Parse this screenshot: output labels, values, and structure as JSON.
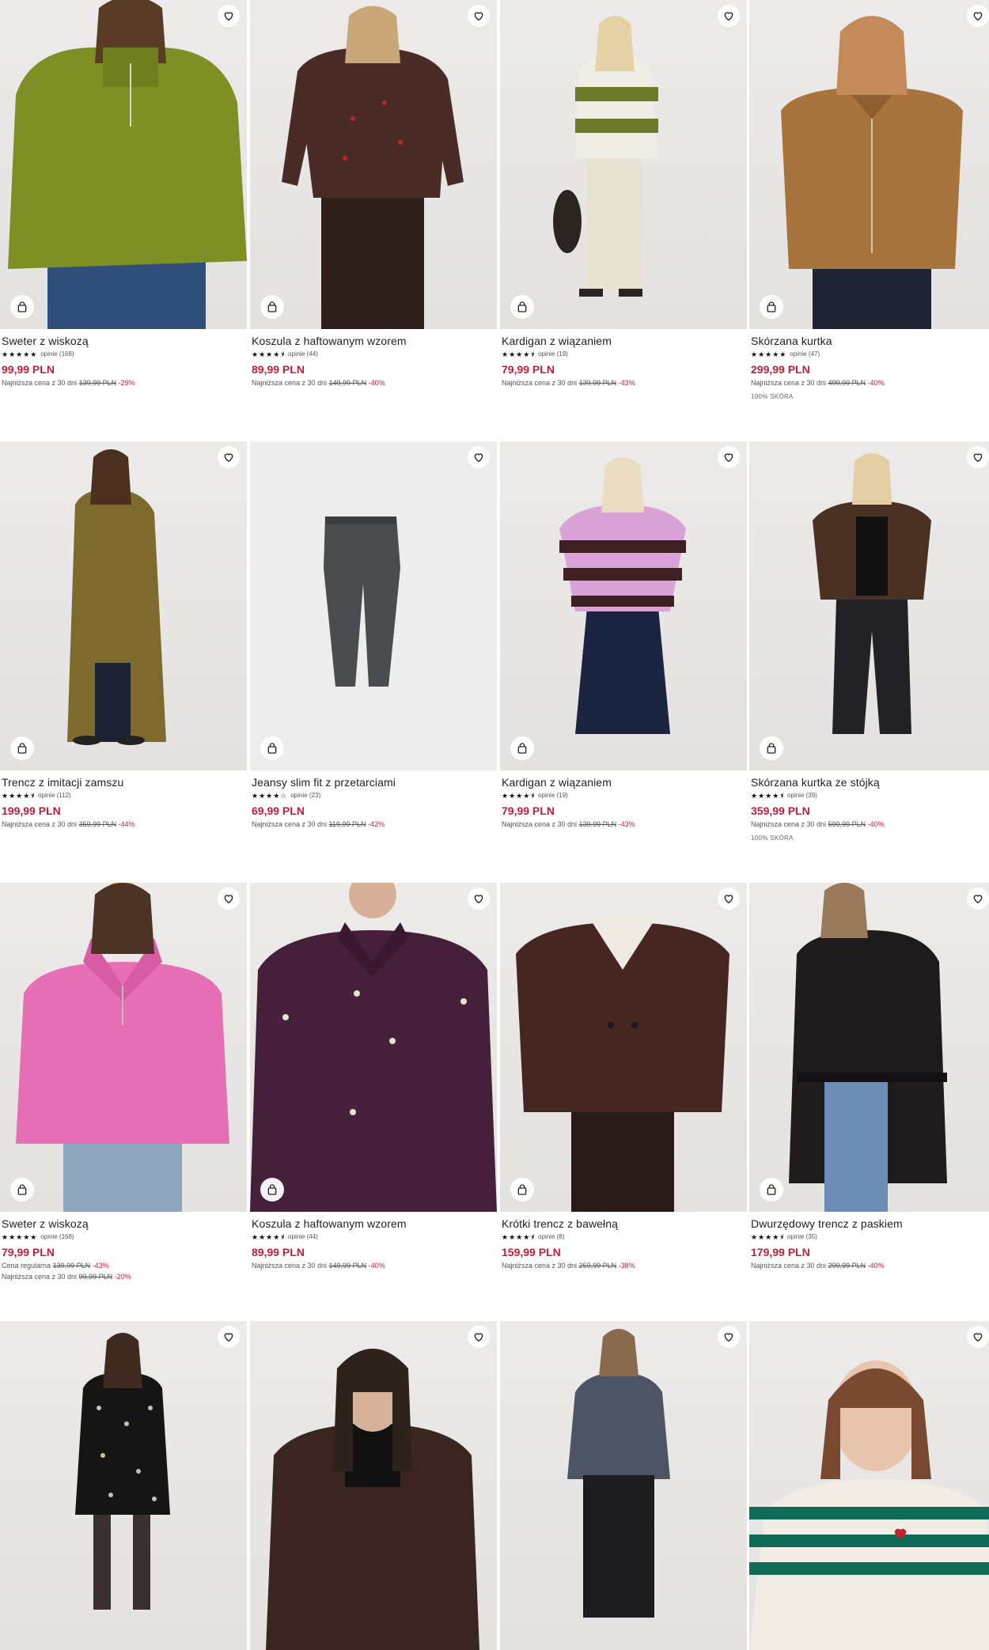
{
  "colors": {
    "price": "#c21d3d",
    "discount": "#c21d3d"
  },
  "icons": {
    "favorite": "heart-icon",
    "cart": "shopping-bag-icon",
    "rating": "star-icon"
  },
  "products": [
    {
      "name": "Sweter z wiskozą",
      "stars": "★★★★★",
      "reviews": "opinie (168)",
      "price": "99,99 PLN",
      "lines": [
        {
          "label": "Najniższa cena z 30 dni",
          "old": "139,99 PLN",
          "discount": "-29%"
        }
      ]
    },
    {
      "name": "Koszula z haftowanym wzorem",
      "stars": "★★★★⯨",
      "reviews": "opinie (44)",
      "price": "89,99 PLN",
      "lines": [
        {
          "label": "Najniższa cena z 30 dni",
          "old": "149,99 PLN",
          "discount": "-40%"
        }
      ]
    },
    {
      "name": "Kardigan z wiązaniem",
      "stars": "★★★★⯨",
      "reviews": "opinie (19)",
      "price": "79,99 PLN",
      "lines": [
        {
          "label": "Najniższa cena z 30 dni",
          "old": "139,99 PLN",
          "discount": "-43%"
        }
      ]
    },
    {
      "name": "Skórzana kurtka",
      "stars": "★★★★★",
      "reviews": "opinie (47)",
      "price": "299,99 PLN",
      "lines": [
        {
          "label": "Najniższa cena z 30 dni",
          "old": "499,99 PLN",
          "discount": "-40%"
        }
      ],
      "material": "100% SKÓRA"
    },
    {
      "name": "Trencz z imitacji zamszu",
      "stars": "★★★★⯨",
      "reviews": "opinie (112)",
      "price": "199,99 PLN",
      "lines": [
        {
          "label": "Najniższa cena z 30 dni",
          "old": "359,99 PLN",
          "discount": "-44%"
        }
      ]
    },
    {
      "name": "Jeansy slim fit z przetarciami",
      "stars": "★★★★☆",
      "reviews": "opinie (23)",
      "price": "69,99 PLN",
      "lines": [
        {
          "label": "Najniższa cena z 30 dni",
          "old": "119,99 PLN",
          "discount": "-42%"
        }
      ]
    },
    {
      "name": "Kardigan z wiązaniem",
      "stars": "★★★★⯨",
      "reviews": "opinie (19)",
      "price": "79,99 PLN",
      "lines": [
        {
          "label": "Najniższa cena z 30 dni",
          "old": "139,99 PLN",
          "discount": "-43%"
        }
      ]
    },
    {
      "name": "Skórzana kurtka ze stójką",
      "stars": "★★★★⯨",
      "reviews": "opinie (39)",
      "price": "359,99 PLN",
      "lines": [
        {
          "label": "Najniższa cena z 30 dni",
          "old": "599,99 PLN",
          "discount": "-40%"
        }
      ],
      "material": "100% SKÓRA"
    },
    {
      "name": "Sweter z wiskozą",
      "stars": "★★★★★",
      "reviews": "opinie (168)",
      "price": "79,99 PLN",
      "lines": [
        {
          "label": "Cena regularna",
          "old": "139,99 PLN",
          "discount": "-43%"
        },
        {
          "label": "Najniższa cena z 30 dni",
          "old": "99,99 PLN",
          "discount": "-20%"
        }
      ]
    },
    {
      "name": "Koszula z haftowanym wzorem",
      "stars": "★★★★⯨",
      "reviews": "opinie (44)",
      "price": "89,99 PLN",
      "lines": [
        {
          "label": "Najniższa cena z 30 dni",
          "old": "149,99 PLN",
          "discount": "-40%"
        }
      ]
    },
    {
      "name": "Krótki trencz z bawełną",
      "stars": "★★★★⯨",
      "reviews": "opinie (8)",
      "price": "159,99 PLN",
      "lines": [
        {
          "label": "Najniższa cena z 30 dni",
          "old": "259,99 PLN",
          "discount": "-38%"
        }
      ]
    },
    {
      "name": "Dwurzędowy trencz z paskiem",
      "stars": "★★★★⯨",
      "reviews": "opinie (35)",
      "price": "179,99 PLN",
      "lines": [
        {
          "label": "Najniższa cena z 30 dni",
          "old": "299,99 PLN",
          "discount": "-40%"
        }
      ]
    },
    {
      "name": "",
      "stars": "",
      "reviews": "",
      "price": "",
      "lines": []
    },
    {
      "name": "",
      "stars": "",
      "reviews": "",
      "price": "",
      "lines": []
    },
    {
      "name": "",
      "stars": "",
      "reviews": "",
      "price": "",
      "lines": []
    },
    {
      "name": "",
      "stars": "",
      "reviews": "",
      "price": "",
      "lines": []
    }
  ]
}
